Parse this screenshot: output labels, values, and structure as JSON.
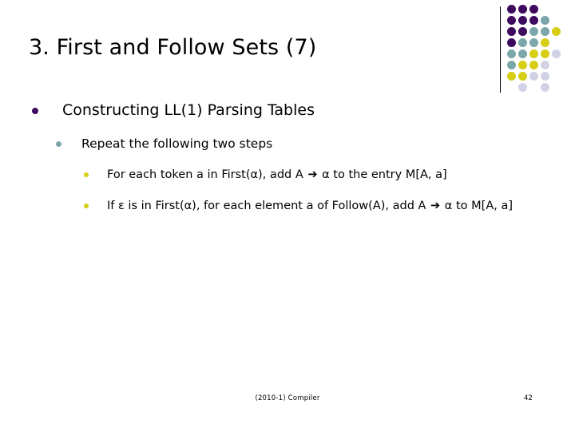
{
  "slide": {
    "title": "3. First and Follow Sets (7)",
    "bullets": {
      "level1": "Constructing LL(1) Parsing Tables",
      "level2": "Repeat the following two steps",
      "level3_item1_a": "For each token a in First(α), add A ",
      "level3_item1_arrow": "➔",
      "level3_item1_b": " α to the entry M[A, a]",
      "level3_item2_a": "If ε is in First(α), for each element a of Follow(A), add A ",
      "level3_item2_arrow": "➔",
      "level3_item2_b": " α to M[A, a]"
    },
    "footer": {
      "center": "(2010-1) Compiler",
      "page_number": "42"
    },
    "colors": {
      "bullet_level1": "#3d0a5e",
      "bullet_level2": "#7ba7ab",
      "bullet_level3": "#d6cf16",
      "deco_purple": "#3d0a5e",
      "deco_teal": "#7ba7ab",
      "deco_yellow": "#d6cf16",
      "deco_lavender": "#d2d2e6",
      "background": "#ffffff",
      "text": "#000000"
    },
    "decoration": {
      "name": "dot-matrix",
      "rows": 8,
      "columns": 5,
      "grid": [
        [
          "purple",
          "purple",
          "purple",
          "empty",
          "empty"
        ],
        [
          "purple",
          "purple",
          "purple",
          "teal",
          "empty"
        ],
        [
          "purple",
          "purple",
          "teal",
          "teal",
          "yellow"
        ],
        [
          "purple",
          "teal",
          "teal",
          "yellow",
          "empty"
        ],
        [
          "teal",
          "teal",
          "yellow",
          "yellow",
          "lavender"
        ],
        [
          "teal",
          "yellow",
          "yellow",
          "lavender",
          "empty"
        ],
        [
          "yellow",
          "yellow",
          "lavender",
          "lavender",
          "empty"
        ],
        [
          "empty",
          "lavender",
          "empty",
          "lavender",
          "empty"
        ]
      ]
    }
  }
}
